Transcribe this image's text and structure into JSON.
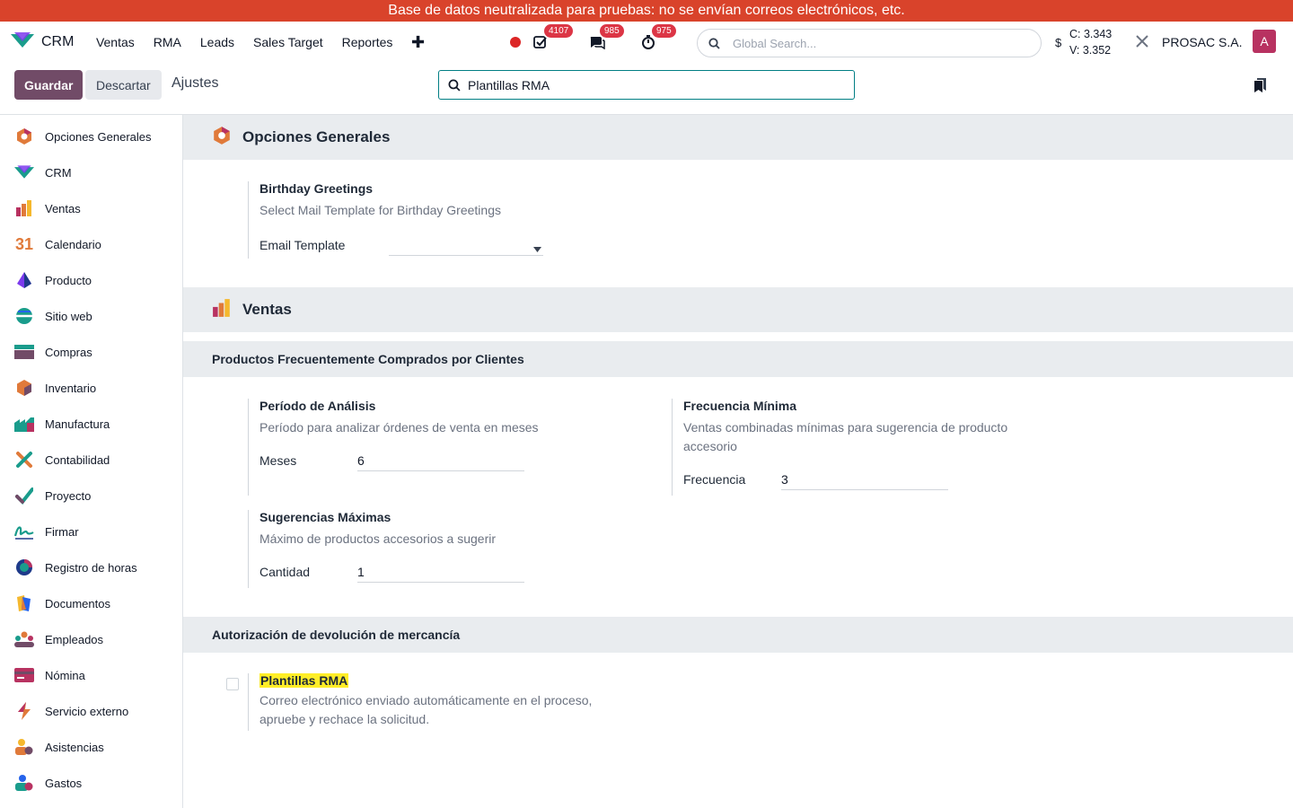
{
  "banner": "Base de datos neutralizada para pruebas: no se envían correos electrónicos, etc.",
  "navbar": {
    "app_name": "CRM",
    "menu": [
      "Ventas",
      "RMA",
      "Leads",
      "Sales Target",
      "Reportes"
    ],
    "badges": {
      "activities": "4107",
      "messages": "985",
      "timers": "975"
    },
    "search_placeholder": "Global Search...",
    "currency_symbol": "$",
    "compra": "C: 3.343",
    "venta": "V: 3.352",
    "company": "PROSAC S.A.",
    "avatar_letter": "A"
  },
  "control": {
    "save": "Guardar",
    "discard": "Descartar",
    "breadcrumb": "Ajustes",
    "search_value": "Plantillas RMA"
  },
  "sidebar": [
    "Opciones Generales",
    "CRM",
    "Ventas",
    "Calendario",
    "Producto",
    "Sitio web",
    "Compras",
    "Inventario",
    "Manufactura",
    "Contabilidad",
    "Proyecto",
    "Firmar",
    "Registro de horas",
    "Documentos",
    "Empleados",
    "Nómina",
    "Servicio externo",
    "Asistencias",
    "Gastos"
  ],
  "sections": {
    "general": {
      "title": "Opciones Generales",
      "birthday": {
        "title": "Birthday Greetings",
        "desc": "Select Mail Template for Birthday Greetings",
        "field_label": "Email Template",
        "field_value": ""
      }
    },
    "ventas": {
      "title": "Ventas",
      "sub": "Productos Frecuentemente Comprados por Clientes",
      "periodo": {
        "title": "Período de Análisis",
        "desc": "Período para analizar órdenes de venta en meses",
        "label": "Meses",
        "value": "6"
      },
      "frecuencia": {
        "title": "Frecuencia Mínima",
        "desc": "Ventas combinadas mínimas para sugerencia de producto accesorio",
        "label": "Frecuencia",
        "value": "3"
      },
      "sugerencias": {
        "title": "Sugerencias Máximas",
        "desc": "Máximo de productos accesorios a sugerir",
        "label": "Cantidad",
        "value": "1"
      }
    },
    "rma": {
      "title": "Autorización de devolución de mercancía",
      "plantillas": {
        "title": "Plantillas RMA",
        "desc": "Correo electrónico enviado automáticamente en el proceso, apruebe y rechace la solicitud.",
        "checked": false
      }
    }
  },
  "colors": {
    "banner": "#d9432b",
    "primary": "#714b67",
    "avatar": "#b83261",
    "highlight": "#ffee27"
  }
}
